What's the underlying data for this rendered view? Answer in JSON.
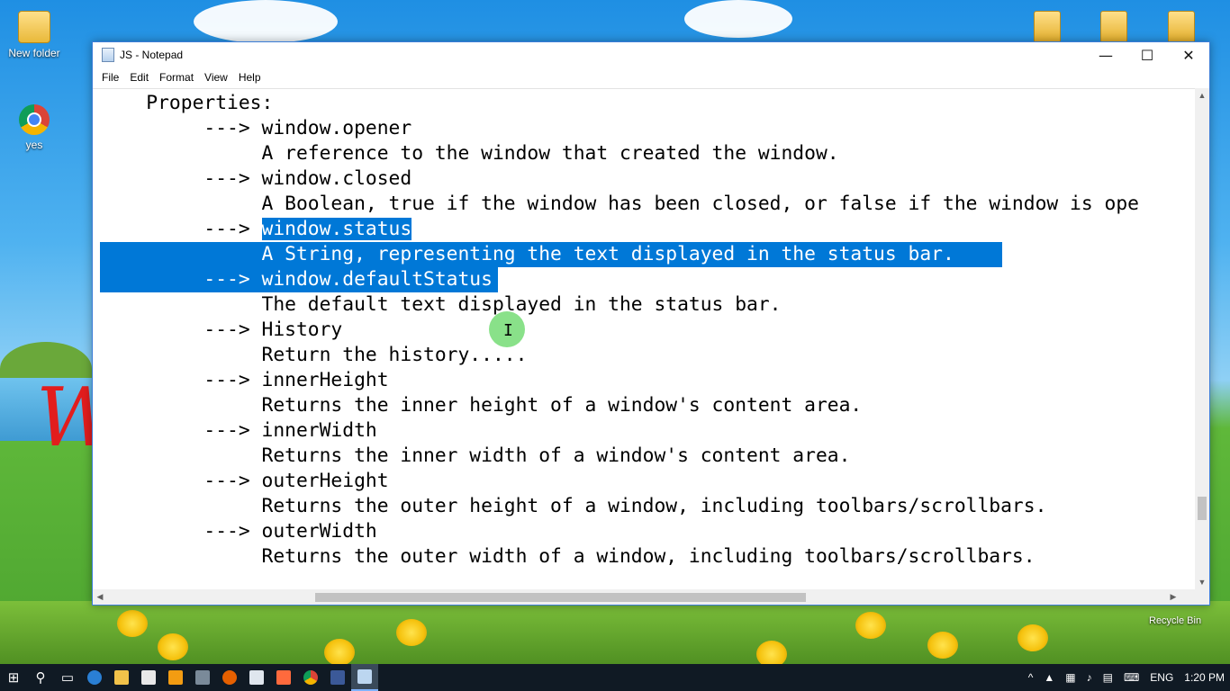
{
  "desktop": {
    "icons": [
      {
        "label": "New folder",
        "icon": "folder-icon"
      },
      {
        "label": "yes",
        "icon": "chrome-icon"
      }
    ],
    "recycle_bin_label": "Recycle Bin"
  },
  "window": {
    "title": "JS - Notepad",
    "controls": {
      "minimize": "—",
      "maximize": "☐",
      "close": "✕"
    },
    "menu": [
      "File",
      "Edit",
      "Format",
      "View",
      "Help"
    ]
  },
  "document": {
    "lines": [
      {
        "pre": "    Properties:",
        "sel": "",
        "post": ""
      },
      {
        "pre": "         ---> window.opener",
        "sel": "",
        "post": ""
      },
      {
        "pre": "              A reference to the window that created the window.",
        "sel": "",
        "post": ""
      },
      {
        "pre": "         ---> window.closed",
        "sel": "",
        "post": ""
      },
      {
        "pre": "              A Boolean, true if the window has been closed, or false if the window is ope",
        "sel": "",
        "post": ""
      },
      {
        "pre": "         ---> ",
        "sel": "window.status",
        "post": ""
      },
      {
        "pre": "",
        "sel": "              A String, representing the text displayed in the status bar.",
        "post": ""
      },
      {
        "pre": "",
        "sel": "         ---> window.defaultStatus",
        "post": ""
      },
      {
        "pre": "              The default text displayed in the status bar.",
        "sel": "",
        "post": ""
      },
      {
        "pre": "         ---> History",
        "sel": "",
        "post": ""
      },
      {
        "pre": "              Return the history.....",
        "sel": "",
        "post": ""
      },
      {
        "pre": "         ---> innerHeight",
        "sel": "",
        "post": ""
      },
      {
        "pre": "              Returns the inner height of a window's content area.",
        "sel": "",
        "post": ""
      },
      {
        "pre": "         ---> innerWidth",
        "sel": "",
        "post": ""
      },
      {
        "pre": "              Returns the inner width of a window's content area.",
        "sel": "",
        "post": ""
      },
      {
        "pre": "         ---> outerHeight",
        "sel": "",
        "post": ""
      },
      {
        "pre": "              Returns the outer height of a window, including toolbars/scrollbars.",
        "sel": "",
        "post": ""
      },
      {
        "pre": "         ---> outerWidth",
        "sel": "",
        "post": ""
      },
      {
        "pre": "              Returns the outer width of a window, including toolbars/scrollbars.",
        "sel": "",
        "post": ""
      }
    ]
  },
  "taskbar": {
    "pinned": [
      "start-icon",
      "search-icon",
      "task-view-icon",
      "edge-icon",
      "file-explorer-icon",
      "store-icon",
      "media-player-icon",
      "calculator-icon",
      "firefox-icon",
      "outlook-icon",
      "paint-icon",
      "chrome-icon",
      "facebook-icon",
      "notepad-icon"
    ],
    "language": "ENG",
    "time": "1:20 PM"
  },
  "colors": {
    "selection": "#0078d7",
    "taskbar": "#101a24"
  }
}
